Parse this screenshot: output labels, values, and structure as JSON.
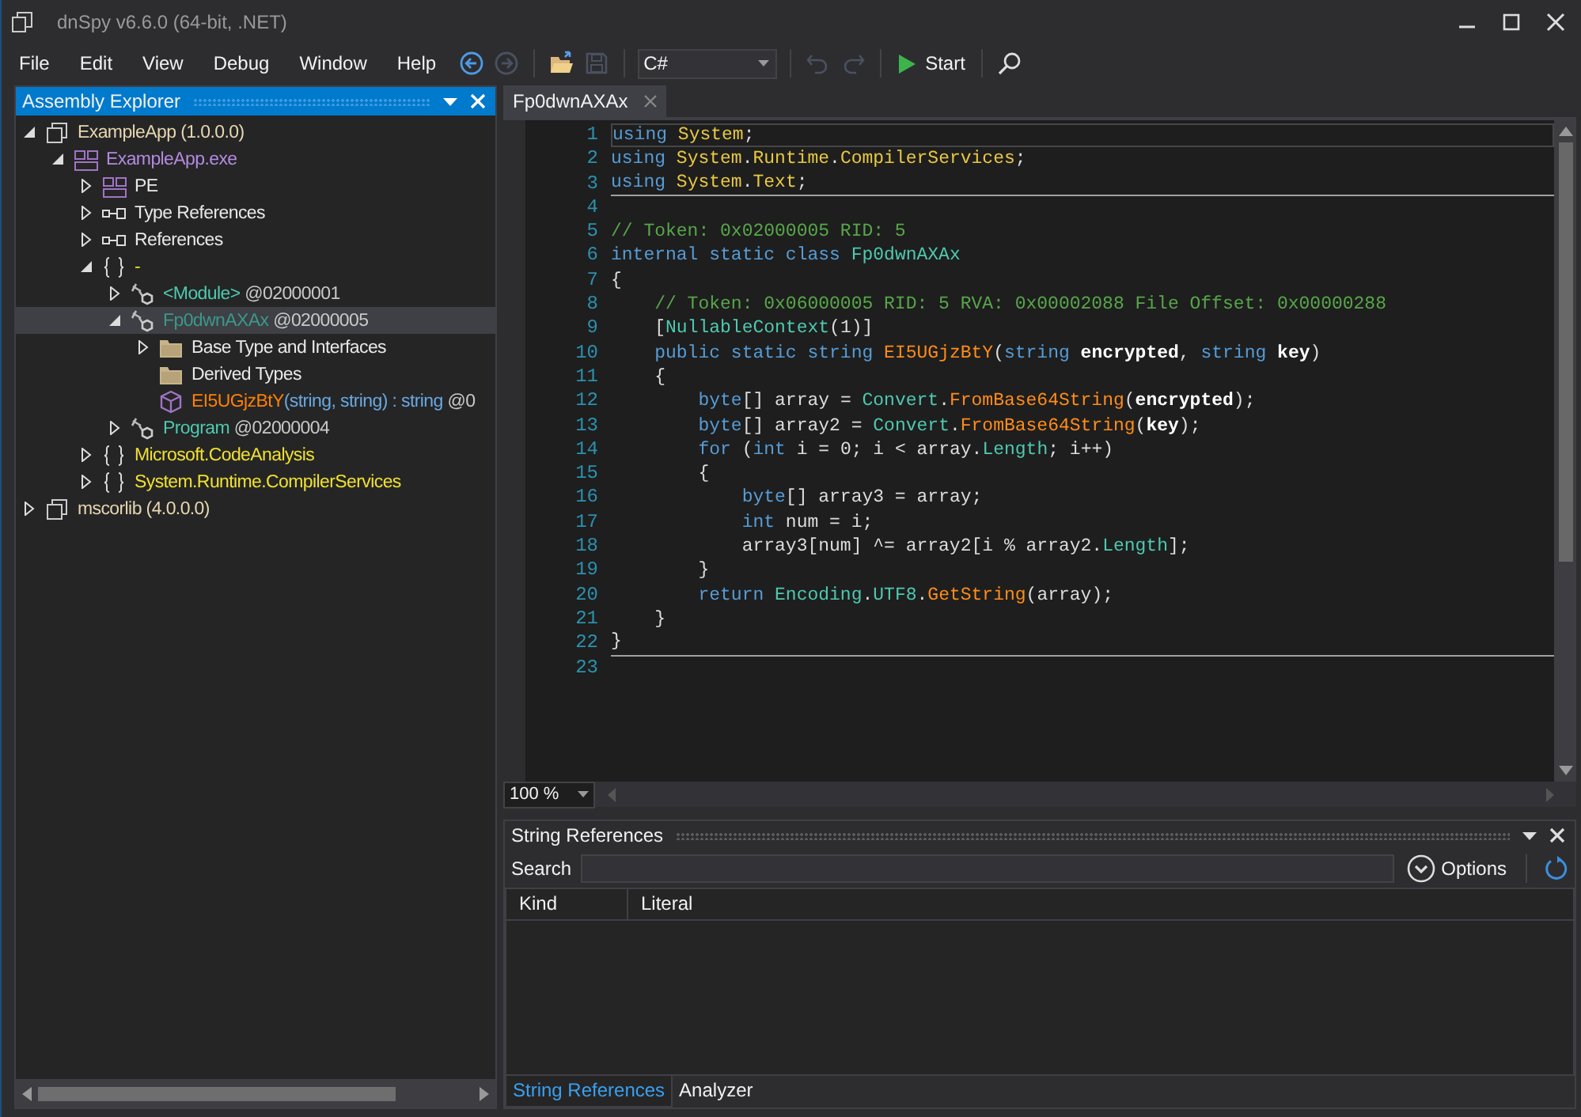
{
  "window": {
    "title": "dnSpy v6.6.0 (64-bit, .NET)"
  },
  "menu": [
    "File",
    "Edit",
    "View",
    "Debug",
    "Window",
    "Help"
  ],
  "toolbar": [
    {
      "kind": "back",
      "disabled": false
    },
    {
      "kind": "forward",
      "disabled": true
    },
    {
      "kind": "separator"
    },
    {
      "kind": "open",
      "disabled": false
    },
    {
      "kind": "save",
      "disabled": true
    },
    {
      "kind": "separator"
    },
    {
      "kind": "language",
      "value": "C#"
    },
    {
      "kind": "separator"
    },
    {
      "kind": "undo",
      "disabled": true
    },
    {
      "kind": "redo",
      "disabled": true
    },
    {
      "kind": "separator"
    },
    {
      "kind": "start",
      "label": "Start",
      "disabled": false
    },
    {
      "kind": "separator"
    },
    {
      "kind": "search",
      "disabled": false
    }
  ],
  "sidebar": {
    "title": "Assembly Explorer",
    "tree": [
      {
        "kind": "assembly",
        "label": "ExampleApp (1.0.0.0)",
        "expanded": true,
        "selected": false,
        "children": [
          {
            "kind": "module",
            "label": "ExampleApp.exe",
            "expanded": true,
            "selected": false,
            "children": [
              {
                "kind": "pe",
                "label": "PE",
                "expanded": false,
                "selected": false
              },
              {
                "kind": "refs",
                "label": "Type References",
                "expanded": false,
                "selected": false
              },
              {
                "kind": "refs",
                "label": "References",
                "expanded": false,
                "selected": false
              },
              {
                "kind": "namespace",
                "label": "-",
                "expanded": true,
                "selected": false,
                "children": [
                  {
                    "kind": "class",
                    "label": "<Module>",
                    "token": "@02000001",
                    "expanded": false,
                    "selected": false
                  },
                  {
                    "kind": "class",
                    "label": "Fp0dwnAXAx",
                    "token": "@02000005",
                    "expanded": true,
                    "selected": true,
                    "children": [
                      {
                        "kind": "folder",
                        "label": "Base Type and Interfaces",
                        "expanded": false,
                        "selected": false
                      },
                      {
                        "kind": "folder",
                        "label": "Derived Types",
                        "selected": false
                      },
                      {
                        "kind": "method",
                        "label": "EI5UGjzBtY",
                        "detail": "(string, string) : string",
                        "token": "@0",
                        "selected": false
                      }
                    ]
                  },
                  {
                    "kind": "class",
                    "label": "Program",
                    "token": "@02000004",
                    "expanded": false,
                    "selected": false
                  }
                ]
              },
              {
                "kind": "namespace",
                "label": "Microsoft.CodeAnalysis",
                "expanded": false,
                "selected": false
              },
              {
                "kind": "namespace",
                "label": "System.Runtime.CompilerServices",
                "expanded": false,
                "selected": false
              }
            ]
          }
        ]
      },
      {
        "kind": "assembly",
        "label": "mscorlib (4.0.0.0)",
        "expanded": false,
        "selected": false
      }
    ]
  },
  "editor": {
    "tabs": [
      {
        "label": "Fp0dwnAXAx",
        "selected": true
      }
    ],
    "zoom": "100 %",
    "lines": [
      {
        "number": "1",
        "current": true,
        "tokens": [
          {
            "t": "using",
            "kind": "keyword"
          },
          {
            "t": " System",
            "kind": "namespace"
          },
          {
            "t": ";",
            "kind": "plain"
          }
        ]
      },
      {
        "number": "2",
        "tokens": [
          {
            "t": "using",
            "kind": "keyword"
          },
          {
            "t": " System",
            "kind": "namespace"
          },
          {
            "t": ".",
            "kind": "plain"
          },
          {
            "t": "Runtime",
            "kind": "namespace"
          },
          {
            "t": ".",
            "kind": "plain"
          },
          {
            "t": "CompilerServices",
            "kind": "namespace"
          },
          {
            "t": ";",
            "kind": "plain"
          }
        ]
      },
      {
        "number": "3",
        "separator": true,
        "tokens": [
          {
            "t": "using",
            "kind": "keyword"
          },
          {
            "t": " System",
            "kind": "namespace"
          },
          {
            "t": ".",
            "kind": "plain"
          },
          {
            "t": "Text",
            "kind": "namespace"
          },
          {
            "t": ";",
            "kind": "plain"
          }
        ]
      },
      {
        "number": "4"
      },
      {
        "number": "5",
        "tokens": [
          {
            "t": "// Token: 0x02000005 RID: 5",
            "kind": "comment"
          }
        ]
      },
      {
        "number": "6",
        "tokens": [
          {
            "t": "internal static class",
            "kind": "keyword"
          },
          {
            "t": " Fp0dwnAXAx",
            "kind": "type"
          }
        ]
      },
      {
        "number": "7",
        "tokens": [
          {
            "t": "{",
            "kind": "plain"
          }
        ]
      },
      {
        "number": "8",
        "tokens": [
          {
            "t": "    // Token: 0x06000005 RID: 5 RVA: 0x00002088 File Offset: 0x00000288",
            "kind": "comment"
          }
        ]
      },
      {
        "number": "9",
        "tokens": [
          {
            "t": "    [",
            "kind": "plain"
          },
          {
            "t": "NullableContext",
            "kind": "type"
          },
          {
            "t": "(1)]",
            "kind": "plain"
          }
        ]
      },
      {
        "number": "10",
        "tokens": [
          {
            "t": "    public static string",
            "kind": "keyword"
          },
          {
            "t": " EI5UGjzBtY",
            "kind": "method"
          },
          {
            "t": "(",
            "kind": "plain"
          },
          {
            "t": "string",
            "kind": "keyword"
          },
          {
            "t": " encrypted",
            "kind": "parameter"
          },
          {
            "t": ", ",
            "kind": "plain"
          },
          {
            "t": "string",
            "kind": "keyword"
          },
          {
            "t": " key",
            "kind": "parameter"
          },
          {
            "t": ")",
            "kind": "plain"
          }
        ]
      },
      {
        "number": "11",
        "tokens": [
          {
            "t": "    {",
            "kind": "plain"
          }
        ]
      },
      {
        "number": "12",
        "tokens": [
          {
            "t": "        byte",
            "kind": "keyword"
          },
          {
            "t": "[] array = ",
            "kind": "plain"
          },
          {
            "t": "Convert",
            "kind": "type"
          },
          {
            "t": ".",
            "kind": "plain"
          },
          {
            "t": "FromBase64String",
            "kind": "method"
          },
          {
            "t": "(",
            "kind": "plain"
          },
          {
            "t": "encrypted",
            "kind": "parameter"
          },
          {
            "t": ");",
            "kind": "plain"
          }
        ]
      },
      {
        "number": "13",
        "tokens": [
          {
            "t": "        byte",
            "kind": "keyword"
          },
          {
            "t": "[] array2 = ",
            "kind": "plain"
          },
          {
            "t": "Convert",
            "kind": "type"
          },
          {
            "t": ".",
            "kind": "plain"
          },
          {
            "t": "FromBase64String",
            "kind": "method"
          },
          {
            "t": "(",
            "kind": "plain"
          },
          {
            "t": "key",
            "kind": "parameter"
          },
          {
            "t": ");",
            "kind": "plain"
          }
        ]
      },
      {
        "number": "14",
        "tokens": [
          {
            "t": "        for",
            "kind": "keyword"
          },
          {
            "t": " (",
            "kind": "plain"
          },
          {
            "t": "int",
            "kind": "keyword"
          },
          {
            "t": " i = 0; i < array.",
            "kind": "plain"
          },
          {
            "t": "Length",
            "kind": "type"
          },
          {
            "t": "; i++)",
            "kind": "plain"
          }
        ]
      },
      {
        "number": "15",
        "tokens": [
          {
            "t": "        {",
            "kind": "plain"
          }
        ]
      },
      {
        "number": "16",
        "tokens": [
          {
            "t": "            byte",
            "kind": "keyword"
          },
          {
            "t": "[] array3 = array;",
            "kind": "plain"
          }
        ]
      },
      {
        "number": "17",
        "tokens": [
          {
            "t": "            int",
            "kind": "keyword"
          },
          {
            "t": " num = i;",
            "kind": "plain"
          }
        ]
      },
      {
        "number": "18",
        "tokens": [
          {
            "t": "            array3[num] ^= array2[i % array2.",
            "kind": "plain"
          },
          {
            "t": "Length",
            "kind": "type"
          },
          {
            "t": "];",
            "kind": "plain"
          }
        ]
      },
      {
        "number": "19",
        "tokens": [
          {
            "t": "        }",
            "kind": "plain"
          }
        ]
      },
      {
        "number": "20",
        "tokens": [
          {
            "t": "        return",
            "kind": "keyword"
          },
          {
            "t": " Encoding",
            "kind": "type"
          },
          {
            "t": ".",
            "kind": "plain"
          },
          {
            "t": "UTF8",
            "kind": "type"
          },
          {
            "t": ".",
            "kind": "plain"
          },
          {
            "t": "GetString",
            "kind": "method"
          },
          {
            "t": "(array);",
            "kind": "plain"
          }
        ]
      },
      {
        "number": "21",
        "tokens": [
          {
            "t": "    }",
            "kind": "plain"
          }
        ]
      },
      {
        "number": "22",
        "separator": true,
        "tokens": [
          {
            "t": "}",
            "kind": "plain"
          }
        ]
      },
      {
        "number": "23"
      }
    ]
  },
  "string_references": {
    "title": "String References",
    "search_label": "Search",
    "options_label": "Options",
    "columns": [
      "Kind",
      "Literal"
    ]
  },
  "bottom_tabs": [
    {
      "label": "String References",
      "selected": true
    },
    {
      "label": "Analyzer",
      "selected": false
    }
  ]
}
